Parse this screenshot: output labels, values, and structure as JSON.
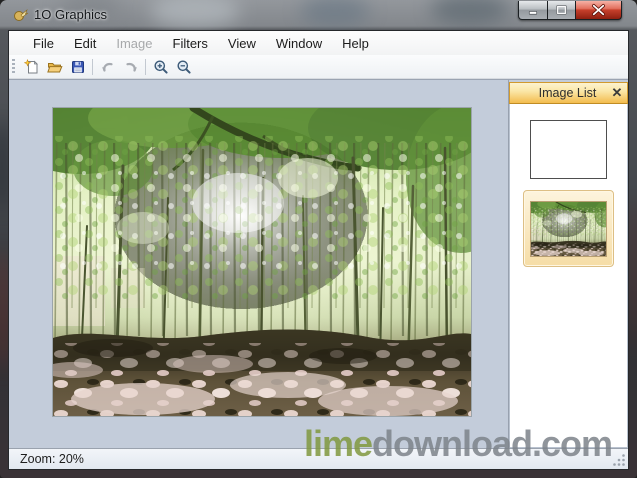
{
  "window": {
    "title": "1O Graphics",
    "controls": [
      "minimize",
      "maximize",
      "close"
    ]
  },
  "menu": {
    "items": [
      {
        "label": "File",
        "enabled": true
      },
      {
        "label": "Edit",
        "enabled": true
      },
      {
        "label": "Image",
        "enabled": false
      },
      {
        "label": "Filters",
        "enabled": true
      },
      {
        "label": "View",
        "enabled": true
      },
      {
        "label": "Window",
        "enabled": true
      },
      {
        "label": "Help",
        "enabled": true
      }
    ]
  },
  "toolbar": {
    "buttons": [
      {
        "icon": "new-file-icon"
      },
      {
        "icon": "open-folder-icon"
      },
      {
        "icon": "save-icon"
      },
      {
        "icon": "undo-icon",
        "disabled": true
      },
      {
        "icon": "redo-icon",
        "disabled": true
      },
      {
        "icon": "zoom-in-icon"
      },
      {
        "icon": "zoom-out-icon"
      }
    ]
  },
  "image_list_panel": {
    "title": "Image List",
    "close_glyph": "✕",
    "thumbnails": [
      {
        "name": "blank-image",
        "selected": false
      },
      {
        "name": "forest-image",
        "selected": true
      }
    ]
  },
  "status_bar": {
    "zoom_text": "Zoom: 20%"
  },
  "watermark": {
    "lime": "lime",
    "rest": "download.com"
  },
  "colors": {
    "canvas_background": "#c3ccda",
    "panel_header_top": "#fdf3d0",
    "panel_header_bottom": "#f3bc4e",
    "close_button_red": "#c6402c",
    "watermark_green": "#80983e",
    "watermark_gray": "#7d838a"
  }
}
